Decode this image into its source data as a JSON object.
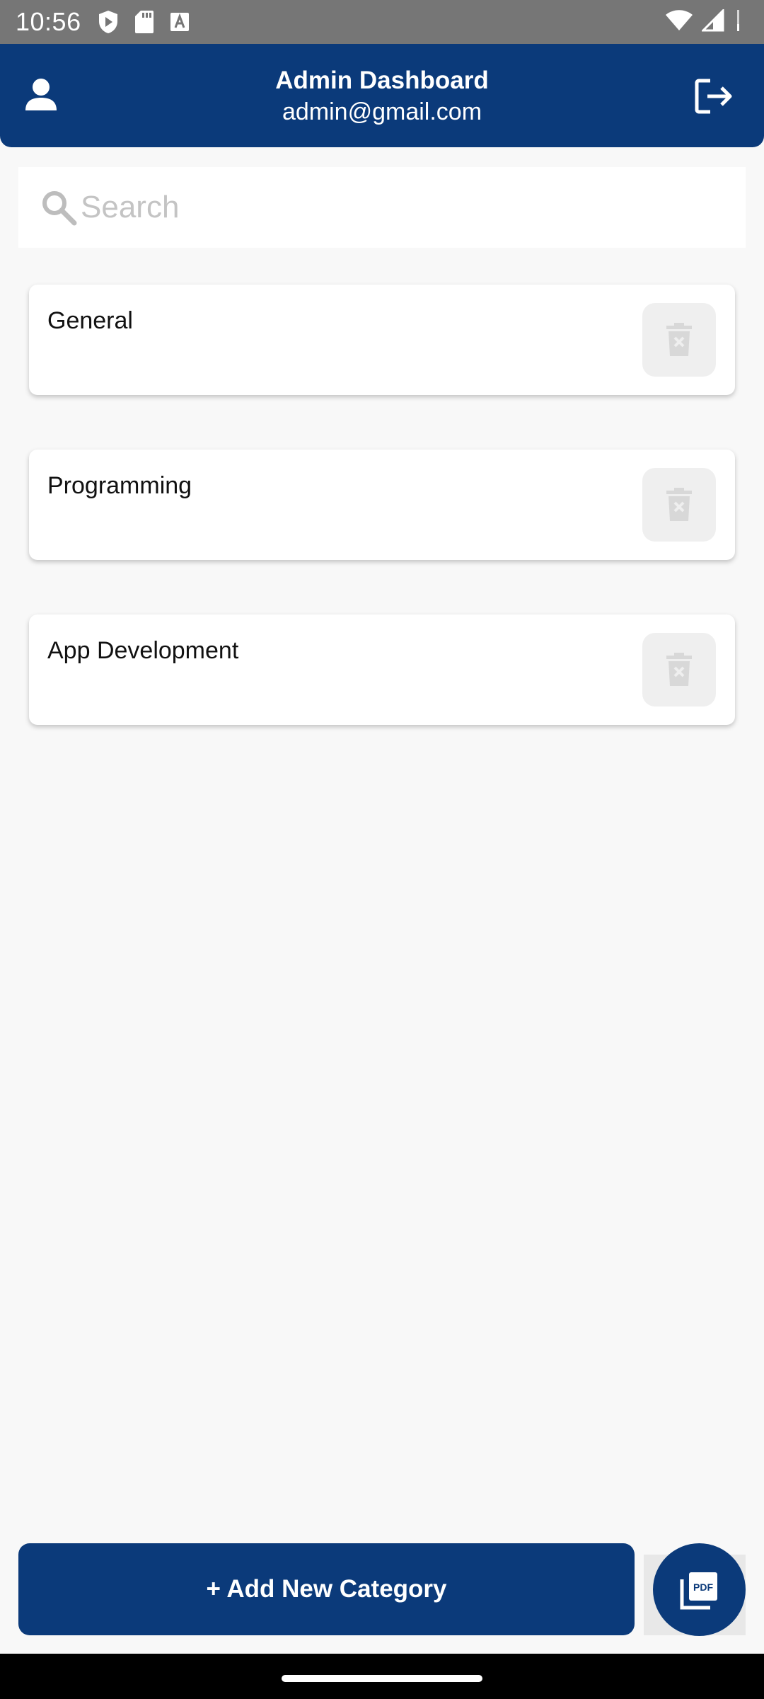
{
  "status_bar": {
    "time": "10:56",
    "left_icons": [
      "shield-icon",
      "sd-card-icon",
      "font-a-icon"
    ],
    "right_icons": [
      "wifi-icon",
      "signal-icon",
      "battery-icon"
    ]
  },
  "header": {
    "title": "Admin Dashboard",
    "email": "admin@gmail.com",
    "left_icon": "profile-icon",
    "right_icon": "logout-icon",
    "background": "#0b3a7a"
  },
  "search": {
    "placeholder": "Search",
    "value": ""
  },
  "categories": [
    {
      "name": "General"
    },
    {
      "name": "Programming"
    },
    {
      "name": "App Development"
    }
  ],
  "footer": {
    "add_label": "+ Add New Category",
    "pdf_icon": "pdf-icon"
  },
  "colors": {
    "primary": "#0b3a7a",
    "background": "#f8f8f8",
    "delete_button": "#efefef"
  }
}
